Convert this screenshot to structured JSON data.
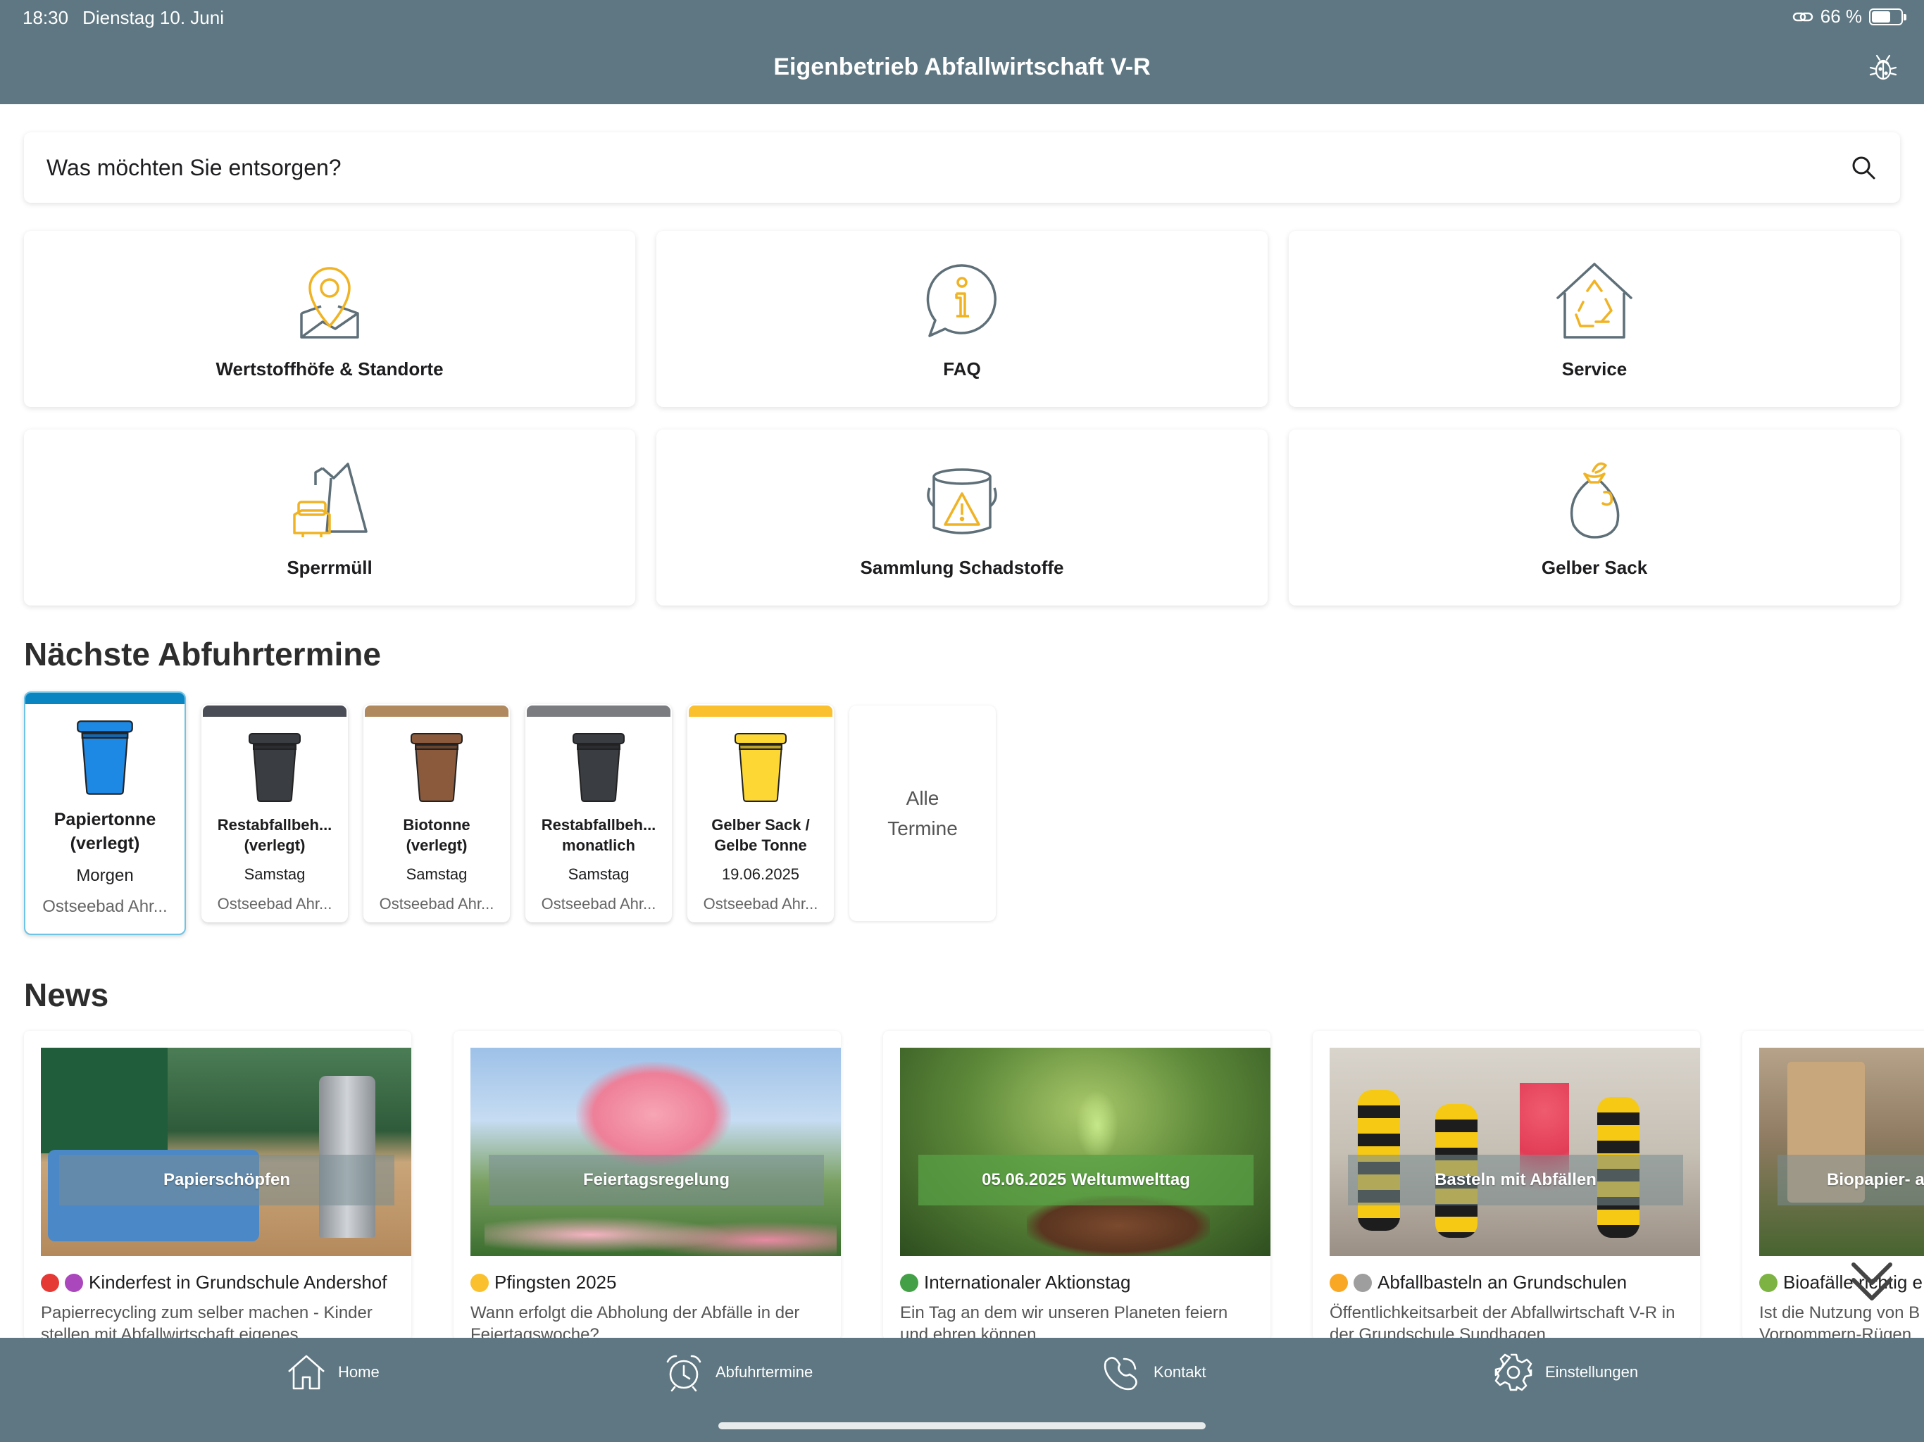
{
  "status_bar": {
    "time": "18:30",
    "date": "Dienstag 10. Juni",
    "battery": "66 %",
    "battery_level": 0.66
  },
  "header": {
    "title": "Eigenbetrieb Abfallwirtschaft V-R"
  },
  "search": {
    "placeholder": "Was möchten Sie entsorgen?"
  },
  "tiles": [
    {
      "label": "Wertstoffhöfe & Standorte",
      "icon": "map-pin-icon"
    },
    {
      "label": "FAQ",
      "icon": "info-bubble-icon"
    },
    {
      "label": "Service",
      "icon": "recycle-house-icon"
    },
    {
      "label": "Sperrmüll",
      "icon": "bulky-waste-icon"
    },
    {
      "label": "Sammlung Schadstoffe",
      "icon": "hazard-bucket-icon"
    },
    {
      "label": "Gelber Sack",
      "icon": "sack-icon"
    }
  ],
  "pickups_title": "Nächste Abfuhrtermine",
  "pickups": [
    {
      "name_line1": "Papiertonne",
      "name_line2": "(verlegt)",
      "date": "Morgen",
      "location": "Ostseebad Ahr...",
      "color": "#1e88e5",
      "bar_color": "#0a85c2"
    },
    {
      "name_line1": "Restabfallbeh...",
      "name_line2": "(verlegt)",
      "date": "Samstag",
      "location": "Ostseebad Ahr...",
      "color": "#3a3d42",
      "bar_color": "#4a4d55"
    },
    {
      "name_line1": "Biotonne",
      "name_line2": "(verlegt)",
      "date": "Samstag",
      "location": "Ostseebad Ahr...",
      "color": "#8b5a3c",
      "bar_color": "#b08a5e"
    },
    {
      "name_line1": "Restabfallbeh...",
      "name_line2": "monatlich",
      "date": "Samstag",
      "location": "Ostseebad Ahr...",
      "color": "#3a3d42",
      "bar_color": "#7a7c80"
    },
    {
      "name_line1": "Gelber Sack /",
      "name_line2": "Gelbe Tonne",
      "date": "19.06.2025",
      "location": "Ostseebad Ahr...",
      "color": "#fdd835",
      "bar_color": "#fbc02d"
    }
  ],
  "all_dates": {
    "line1": "Alle",
    "line2": "Termine"
  },
  "news_title": "News",
  "news": [
    {
      "overlay": "Papierschöpfen",
      "title": "Kinderfest in Grundschule Andershof",
      "text": "Papierrecycling zum selber machen - Kinder stellen mit Abfallwirtschaft eigenes",
      "emoji_colors": [
        "#e53935",
        "#ab47bc"
      ]
    },
    {
      "overlay": "Feiertagsregelung",
      "title": "Pfingsten 2025",
      "text": "Wann erfolgt die Abholung der Abfälle in der Feiertagswoche?",
      "emoji_colors": [
        "#fbc02d"
      ]
    },
    {
      "overlay": "05.06.2025 Weltumwelttag",
      "title": "Internationaler Aktionstag",
      "text": "Ein Tag an dem wir unseren Planeten feiern und ehren können",
      "emoji_colors": [
        "#43a047"
      ]
    },
    {
      "overlay": "Basteln mit Abfällen",
      "title": "Abfallbasteln an Grundschulen",
      "text": "Öffentlichkeitsarbeit der Abfallwirtschaft V-R in der Grundschule Sundhagen",
      "emoji_colors": [
        "#f9a825",
        "#9e9e9e"
      ]
    },
    {
      "overlay": "Biopapier- a",
      "title": "Bioafälle richtig e",
      "text": "Ist die Nutzung von B Vorpommern-Rügen",
      "emoji_colors": [
        "#7cb342"
      ]
    }
  ],
  "tabs": [
    {
      "label": "Home",
      "icon": "home-icon"
    },
    {
      "label": "Abfuhrtermine",
      "icon": "alarm-clock-icon"
    },
    {
      "label": "Kontakt",
      "icon": "phone-icon"
    },
    {
      "label": "Einstellungen",
      "icon": "gear-icon"
    }
  ]
}
